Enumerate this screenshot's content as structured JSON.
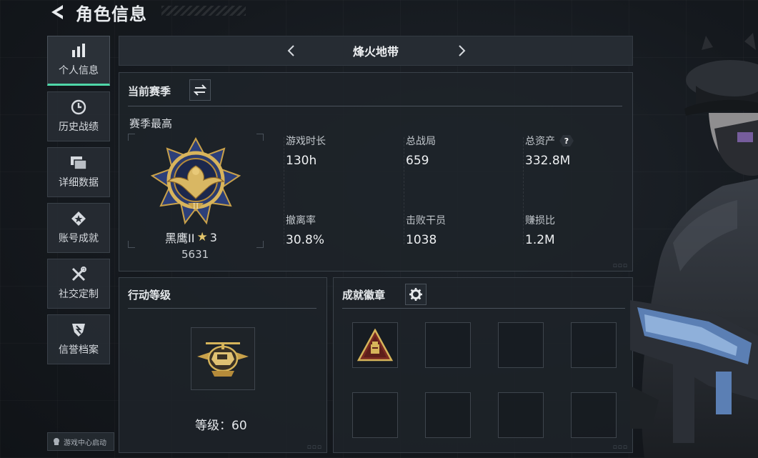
{
  "header": {
    "title": "角色信息"
  },
  "sidebar": {
    "items": [
      {
        "label": "个人信息",
        "icon": "bar-chart-icon",
        "active": true
      },
      {
        "label": "历史战绩",
        "icon": "clock-icon",
        "active": false
      },
      {
        "label": "详细数据",
        "icon": "folder-icon",
        "active": false
      },
      {
        "label": "账号成就",
        "icon": "achievement-icon",
        "active": false
      },
      {
        "label": "社交定制",
        "icon": "wrench-icon",
        "active": false
      },
      {
        "label": "信誉档案",
        "icon": "shield-icon",
        "active": false
      }
    ],
    "launch_badge": "游戏中心启动"
  },
  "mode": {
    "title": "烽火地带"
  },
  "season": {
    "title": "当前赛季",
    "best_label": "赛季最高",
    "rank_name": "黑鹰II",
    "rank_stars": "3",
    "rank_score": "5631",
    "stats": [
      {
        "label": "游戏时长",
        "value": "130h"
      },
      {
        "label": "总战局",
        "value": "659"
      },
      {
        "label": "总资产",
        "value": "332.8M",
        "help": "?"
      },
      {
        "label": "撤离率",
        "value": "30.8%"
      },
      {
        "label": "击败干员",
        "value": "1038"
      },
      {
        "label": "赚损比",
        "value": "1.2M"
      }
    ]
  },
  "level": {
    "title": "行动等级",
    "level_text": "等级：60"
  },
  "achievements": {
    "title": "成就徽章",
    "slots_filled": 1,
    "slots_total": 8
  },
  "colors": {
    "accent": "#4fd7a8",
    "gold": "#d6b45a",
    "panel": "#1e2329"
  }
}
